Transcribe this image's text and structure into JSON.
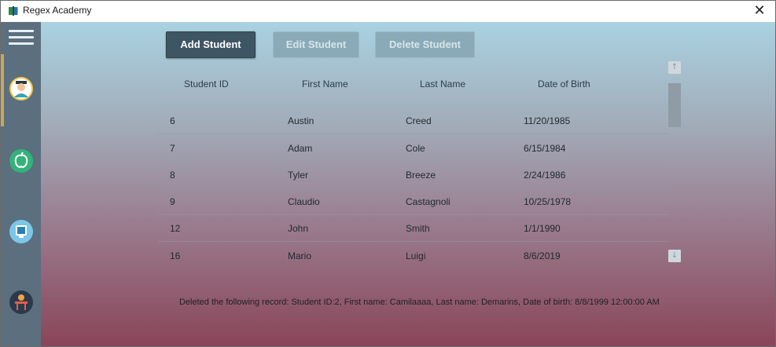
{
  "window": {
    "title": "Regex Academy"
  },
  "sidebar": {
    "items": [
      {
        "name": "students",
        "icon": "student-icon",
        "active": true
      },
      {
        "name": "subjects",
        "icon": "apple-icon",
        "active": false
      },
      {
        "name": "exams",
        "icon": "monitor-icon",
        "active": false
      },
      {
        "name": "classroom",
        "icon": "desk-icon",
        "active": false
      }
    ]
  },
  "toolbar": {
    "add_label": "Add Student",
    "edit_label": "Edit Student",
    "delete_label": "Delete Student"
  },
  "table": {
    "columns": [
      "Student ID",
      "First Name",
      "Last Name",
      "Date of Birth"
    ],
    "rows": [
      [
        "6",
        "Austin",
        "Creed",
        "11/20/1985"
      ],
      [
        "7",
        "Adam",
        "Cole",
        "6/15/1984"
      ],
      [
        "8",
        "Tyler",
        "Breeze",
        "2/24/1986"
      ],
      [
        "9",
        "Claudio",
        "Castagnoli",
        "10/25/1978"
      ],
      [
        "12",
        "John",
        "Smith",
        "1/1/1990"
      ],
      [
        "16",
        "Mario",
        "Luigi",
        "8/6/2019"
      ]
    ]
  },
  "status": {
    "message": "Deleted the following record: Student ID:2, First name: Camilaaaa, Last name: Demarins, Date of birth: 8/8/1999 12:00:00 AM"
  },
  "colors": {
    "sidebar": "#5b6f7e",
    "primary_button": "#3e5563",
    "disabled_button": "#8aaab7",
    "active_indicator": "#c8a860"
  }
}
